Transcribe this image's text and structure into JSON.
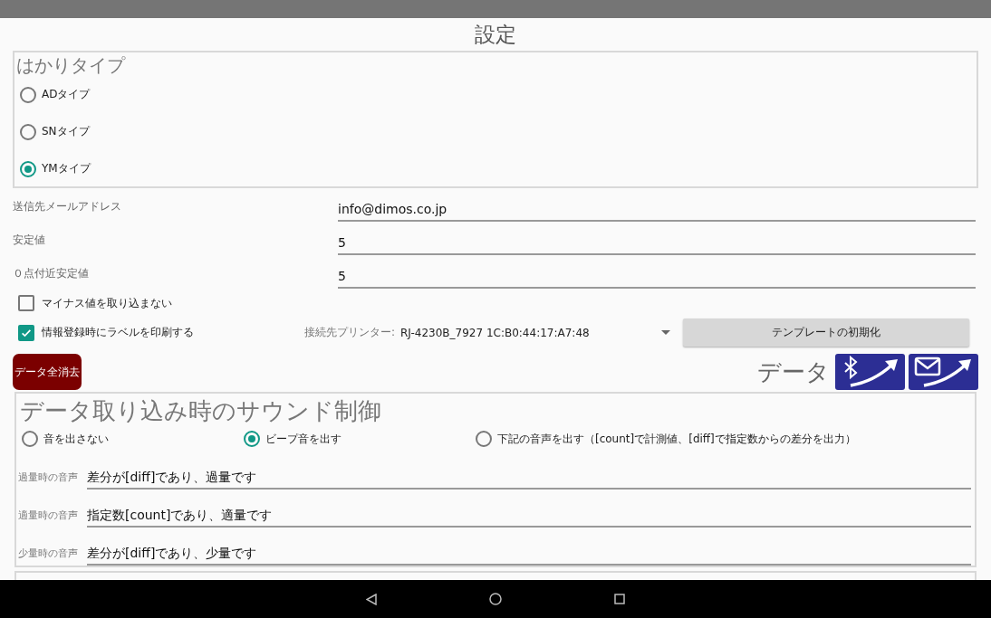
{
  "title": "設定",
  "scale_type": {
    "heading": "はかりタイプ",
    "options": [
      {
        "label": "ADタイプ",
        "selected": false
      },
      {
        "label": "SNタイプ",
        "selected": false
      },
      {
        "label": "YMタイプ",
        "selected": true
      }
    ]
  },
  "fields": [
    {
      "label": "送信先メールアドレス",
      "value": "info@dimos.co.jp"
    },
    {
      "label": "安定値",
      "value": "5"
    },
    {
      "label": "０点付近安定値",
      "value": "5"
    }
  ],
  "checkboxes": [
    {
      "label": "マイナス値を取り込まない",
      "checked": false
    },
    {
      "label": "情報登録時にラベルを印刷する",
      "checked": true
    }
  ],
  "printer": {
    "label": "接続先プリンター:",
    "value": "RJ-4230B_7927 1C:B0:44:17:A7:48"
  },
  "template_button": "テンプレートの初期化",
  "delete_button": "データ全消去",
  "export": {
    "label": "データ"
  },
  "sound": {
    "heading": "データ取り込み時のサウンド制御",
    "options": [
      {
        "label": "音を出さない",
        "selected": false
      },
      {
        "label": "ビープ音を出す",
        "selected": true
      },
      {
        "label": "下記の音声を出す（[count]で計測値、[diff]で指定数からの差分を出力）",
        "selected": false
      }
    ],
    "voices": [
      {
        "label": "過量時の音声",
        "value": "差分が[diff]であり、過量です"
      },
      {
        "label": "適量時の音声",
        "value": "指定数[count]であり、適量です"
      },
      {
        "label": "少量時の音声",
        "value": "差分が[diff]であり、少量です"
      }
    ]
  }
}
